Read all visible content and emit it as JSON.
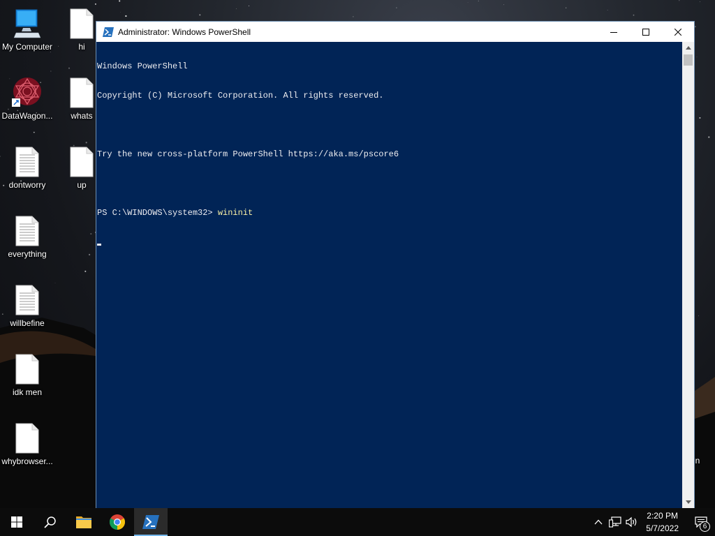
{
  "desktop": {
    "icons": [
      {
        "label": "My Computer",
        "type": "computer"
      },
      {
        "label": "hi",
        "type": "blank-file"
      },
      {
        "label": "DataWagon...",
        "type": "shortcut"
      },
      {
        "label": "whats",
        "type": "blank-file"
      },
      {
        "label": "dontworry",
        "type": "text-file"
      },
      {
        "label": "up",
        "type": "blank-file"
      },
      {
        "label": "everything",
        "type": "text-file"
      },
      {
        "label": "willbefine",
        "type": "text-file"
      },
      {
        "label": "idk men",
        "type": "blank-file"
      },
      {
        "label": "whybrowser...",
        "type": "blank-file"
      }
    ],
    "offscreen_label": "in"
  },
  "window": {
    "title": "Administrator: Windows PowerShell",
    "icon": "powershell-icon",
    "buttons": {
      "minimize": "minimize-icon",
      "maximize": "maximize-icon",
      "close": "close-icon"
    }
  },
  "console": {
    "lines": [
      "Windows PowerShell",
      "Copyright (C) Microsoft Corporation. All rights reserved.",
      "",
      "Try the new cross-platform PowerShell https://aka.ms/pscore6",
      ""
    ],
    "prompt": "PS C:\\WINDOWS\\system32> ",
    "command": "wininit",
    "colors": {
      "background": "#012456",
      "text": "#eeedf0",
      "command": "#f9f1a5"
    }
  },
  "taskbar": {
    "buttons": [
      "start-icon",
      "search-icon",
      "file-explorer-icon",
      "chrome-icon",
      "powershell-icon"
    ],
    "active": "powershell-icon",
    "tray": [
      "chevron-up-icon",
      "network-icon",
      "volume-icon"
    ],
    "time": "2:20 PM",
    "date": "5/7/2022",
    "notifications_count": "6"
  }
}
